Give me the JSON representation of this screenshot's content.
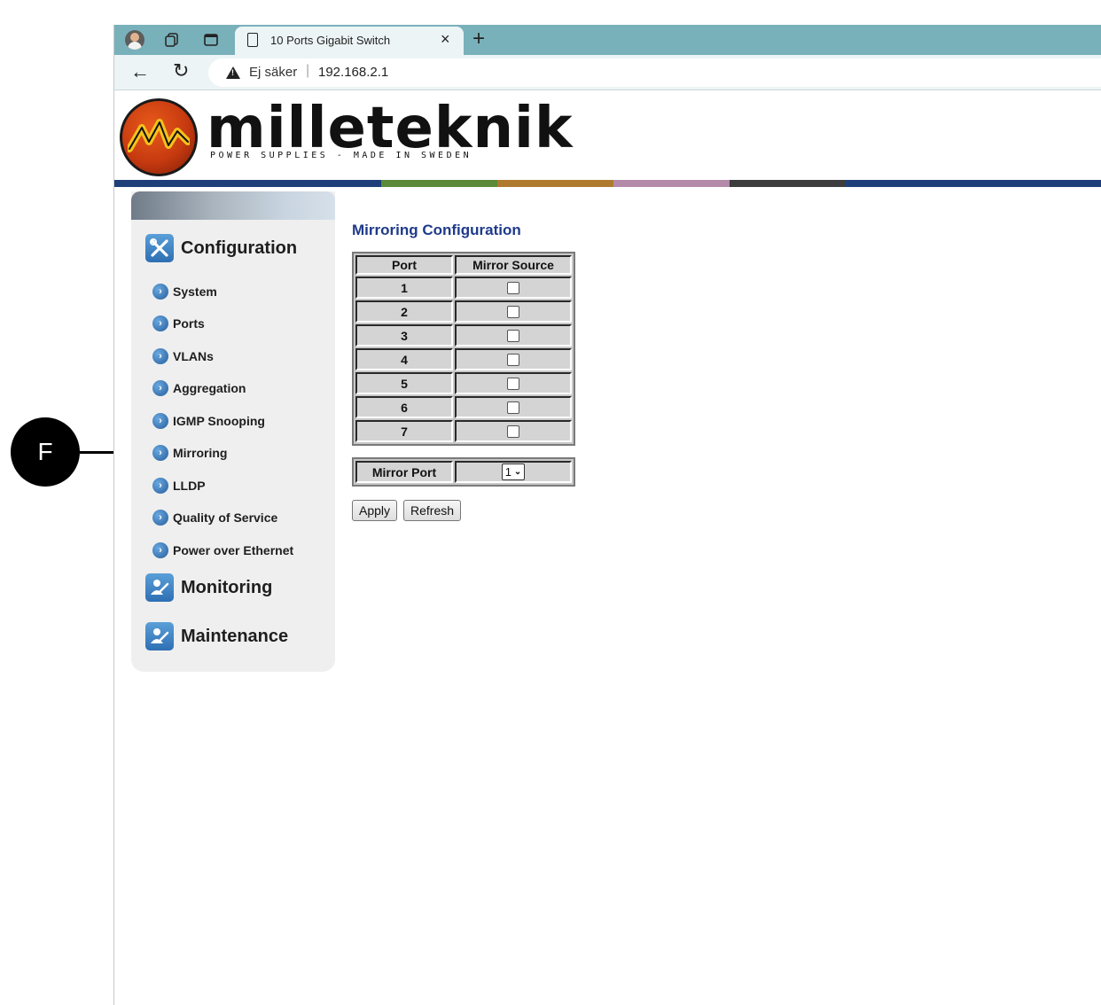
{
  "callout": {
    "label": "F"
  },
  "browser": {
    "tab_title": "10 Ports Gigabit Switch",
    "tab_close": "×",
    "new_tab": "+",
    "security_text": "Ej säker",
    "url_separator": "|",
    "url": "192.168.2.1"
  },
  "logo": {
    "name": "milleteknik",
    "tagline": "POWER SUPPLIES - MADE IN SWEDEN"
  },
  "colorbar": [
    "#1f3f7a",
    "#1f3f7a",
    "#5a8a3a",
    "#b07a2e",
    "#b48aaa",
    "#3d3d3d",
    "#1f3f7a",
    "#1f3f7a"
  ],
  "sidebar": {
    "configuration": "Configuration",
    "items": [
      {
        "label": "System"
      },
      {
        "label": "Ports"
      },
      {
        "label": "VLANs"
      },
      {
        "label": "Aggregation"
      },
      {
        "label": "IGMP Snooping"
      },
      {
        "label": "Mirroring"
      },
      {
        "label": "LLDP"
      },
      {
        "label": "Quality of Service"
      },
      {
        "label": "Power over Ethernet"
      }
    ],
    "monitoring": "Monitoring",
    "maintenance": "Maintenance"
  },
  "content": {
    "title": "Mirroring Configuration",
    "columns": {
      "port": "Port",
      "mirror_source": "Mirror Source"
    },
    "ports": [
      "1",
      "2",
      "3",
      "4",
      "5",
      "6",
      "7"
    ],
    "mirror_source_checked": [
      false,
      false,
      false,
      false,
      false,
      false,
      false
    ],
    "mirror_port_label": "Mirror Port",
    "mirror_port_value": "1",
    "apply": "Apply",
    "refresh": "Refresh"
  }
}
